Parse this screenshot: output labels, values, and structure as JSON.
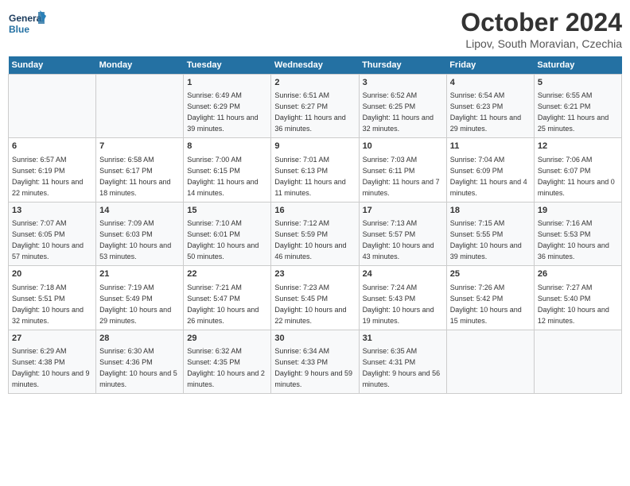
{
  "header": {
    "logo_line1": "General",
    "logo_line2": "Blue",
    "month": "October 2024",
    "location": "Lipov, South Moravian, Czechia"
  },
  "days_of_week": [
    "Sunday",
    "Monday",
    "Tuesday",
    "Wednesday",
    "Thursday",
    "Friday",
    "Saturday"
  ],
  "weeks": [
    [
      {
        "day": "",
        "info": ""
      },
      {
        "day": "",
        "info": ""
      },
      {
        "day": "1",
        "info": "Sunrise: 6:49 AM\nSunset: 6:29 PM\nDaylight: 11 hours and 39 minutes."
      },
      {
        "day": "2",
        "info": "Sunrise: 6:51 AM\nSunset: 6:27 PM\nDaylight: 11 hours and 36 minutes."
      },
      {
        "day": "3",
        "info": "Sunrise: 6:52 AM\nSunset: 6:25 PM\nDaylight: 11 hours and 32 minutes."
      },
      {
        "day": "4",
        "info": "Sunrise: 6:54 AM\nSunset: 6:23 PM\nDaylight: 11 hours and 29 minutes."
      },
      {
        "day": "5",
        "info": "Sunrise: 6:55 AM\nSunset: 6:21 PM\nDaylight: 11 hours and 25 minutes."
      }
    ],
    [
      {
        "day": "6",
        "info": "Sunrise: 6:57 AM\nSunset: 6:19 PM\nDaylight: 11 hours and 22 minutes."
      },
      {
        "day": "7",
        "info": "Sunrise: 6:58 AM\nSunset: 6:17 PM\nDaylight: 11 hours and 18 minutes."
      },
      {
        "day": "8",
        "info": "Sunrise: 7:00 AM\nSunset: 6:15 PM\nDaylight: 11 hours and 14 minutes."
      },
      {
        "day": "9",
        "info": "Sunrise: 7:01 AM\nSunset: 6:13 PM\nDaylight: 11 hours and 11 minutes."
      },
      {
        "day": "10",
        "info": "Sunrise: 7:03 AM\nSunset: 6:11 PM\nDaylight: 11 hours and 7 minutes."
      },
      {
        "day": "11",
        "info": "Sunrise: 7:04 AM\nSunset: 6:09 PM\nDaylight: 11 hours and 4 minutes."
      },
      {
        "day": "12",
        "info": "Sunrise: 7:06 AM\nSunset: 6:07 PM\nDaylight: 11 hours and 0 minutes."
      }
    ],
    [
      {
        "day": "13",
        "info": "Sunrise: 7:07 AM\nSunset: 6:05 PM\nDaylight: 10 hours and 57 minutes."
      },
      {
        "day": "14",
        "info": "Sunrise: 7:09 AM\nSunset: 6:03 PM\nDaylight: 10 hours and 53 minutes."
      },
      {
        "day": "15",
        "info": "Sunrise: 7:10 AM\nSunset: 6:01 PM\nDaylight: 10 hours and 50 minutes."
      },
      {
        "day": "16",
        "info": "Sunrise: 7:12 AM\nSunset: 5:59 PM\nDaylight: 10 hours and 46 minutes."
      },
      {
        "day": "17",
        "info": "Sunrise: 7:13 AM\nSunset: 5:57 PM\nDaylight: 10 hours and 43 minutes."
      },
      {
        "day": "18",
        "info": "Sunrise: 7:15 AM\nSunset: 5:55 PM\nDaylight: 10 hours and 39 minutes."
      },
      {
        "day": "19",
        "info": "Sunrise: 7:16 AM\nSunset: 5:53 PM\nDaylight: 10 hours and 36 minutes."
      }
    ],
    [
      {
        "day": "20",
        "info": "Sunrise: 7:18 AM\nSunset: 5:51 PM\nDaylight: 10 hours and 32 minutes."
      },
      {
        "day": "21",
        "info": "Sunrise: 7:19 AM\nSunset: 5:49 PM\nDaylight: 10 hours and 29 minutes."
      },
      {
        "day": "22",
        "info": "Sunrise: 7:21 AM\nSunset: 5:47 PM\nDaylight: 10 hours and 26 minutes."
      },
      {
        "day": "23",
        "info": "Sunrise: 7:23 AM\nSunset: 5:45 PM\nDaylight: 10 hours and 22 minutes."
      },
      {
        "day": "24",
        "info": "Sunrise: 7:24 AM\nSunset: 5:43 PM\nDaylight: 10 hours and 19 minutes."
      },
      {
        "day": "25",
        "info": "Sunrise: 7:26 AM\nSunset: 5:42 PM\nDaylight: 10 hours and 15 minutes."
      },
      {
        "day": "26",
        "info": "Sunrise: 7:27 AM\nSunset: 5:40 PM\nDaylight: 10 hours and 12 minutes."
      }
    ],
    [
      {
        "day": "27",
        "info": "Sunrise: 6:29 AM\nSunset: 4:38 PM\nDaylight: 10 hours and 9 minutes."
      },
      {
        "day": "28",
        "info": "Sunrise: 6:30 AM\nSunset: 4:36 PM\nDaylight: 10 hours and 5 minutes."
      },
      {
        "day": "29",
        "info": "Sunrise: 6:32 AM\nSunset: 4:35 PM\nDaylight: 10 hours and 2 minutes."
      },
      {
        "day": "30",
        "info": "Sunrise: 6:34 AM\nSunset: 4:33 PM\nDaylight: 9 hours and 59 minutes."
      },
      {
        "day": "31",
        "info": "Sunrise: 6:35 AM\nSunset: 4:31 PM\nDaylight: 9 hours and 56 minutes."
      },
      {
        "day": "",
        "info": ""
      },
      {
        "day": "",
        "info": ""
      }
    ]
  ]
}
